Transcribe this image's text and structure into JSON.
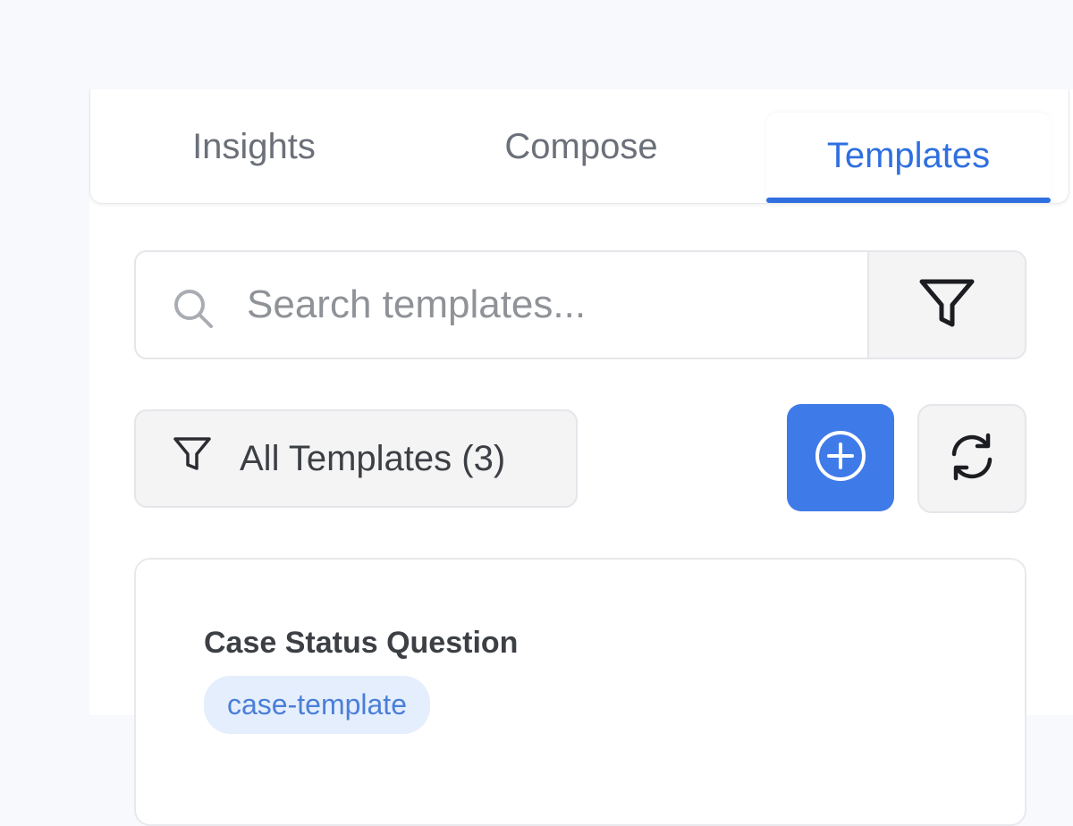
{
  "tabs": {
    "insights": "Insights",
    "compose": "Compose",
    "templates": "Templates",
    "active": "templates"
  },
  "search": {
    "placeholder": "Search templates...",
    "value": "",
    "icon": "search-icon"
  },
  "toolbar": {
    "filter_icon": "filter-icon",
    "scope_label": "All Templates (3)",
    "add_icon": "plus-circle-icon",
    "refresh_icon": "refresh-icon"
  },
  "templates": [
    {
      "title": "Case Status Question",
      "tag": "case-template"
    }
  ],
  "colors": {
    "accent": "#2f6fe0",
    "add_button": "#3f7be8",
    "tag_bg": "#e5eefc",
    "tag_text": "#4a7fd8",
    "background": "#f8f9fc"
  }
}
